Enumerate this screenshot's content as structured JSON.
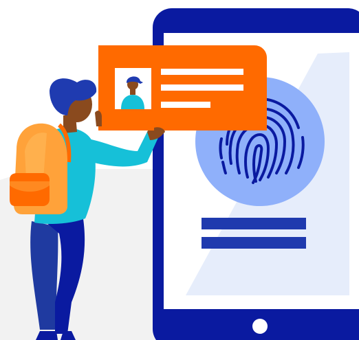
{
  "illustration": {
    "subject": "fingerprint-identity-verification",
    "icons": [
      "tablet",
      "fingerprint-icon",
      "id-card",
      "user-avatar-icon",
      "person",
      "backpack"
    ],
    "colors": {
      "tablet_frame": "#0a1aa0",
      "tablet_screen": "#ffffff",
      "screen_shape": "#e6edfb",
      "fingerprint_circle": "#8fb0fa",
      "fingerprint_lines": "#0a1aa0",
      "screen_bars": "#1f3aae",
      "card": "#ff6a00",
      "card_lines": "#ffffff",
      "skin": "#8a4a1e",
      "hair": "#1f3bb0",
      "shirt": "#16c0d8",
      "pants": "#0a1aa0",
      "backpack": "#ffa23a",
      "backpack_dark": "#ff6a00",
      "backdrop": "#f2f2f2"
    }
  }
}
